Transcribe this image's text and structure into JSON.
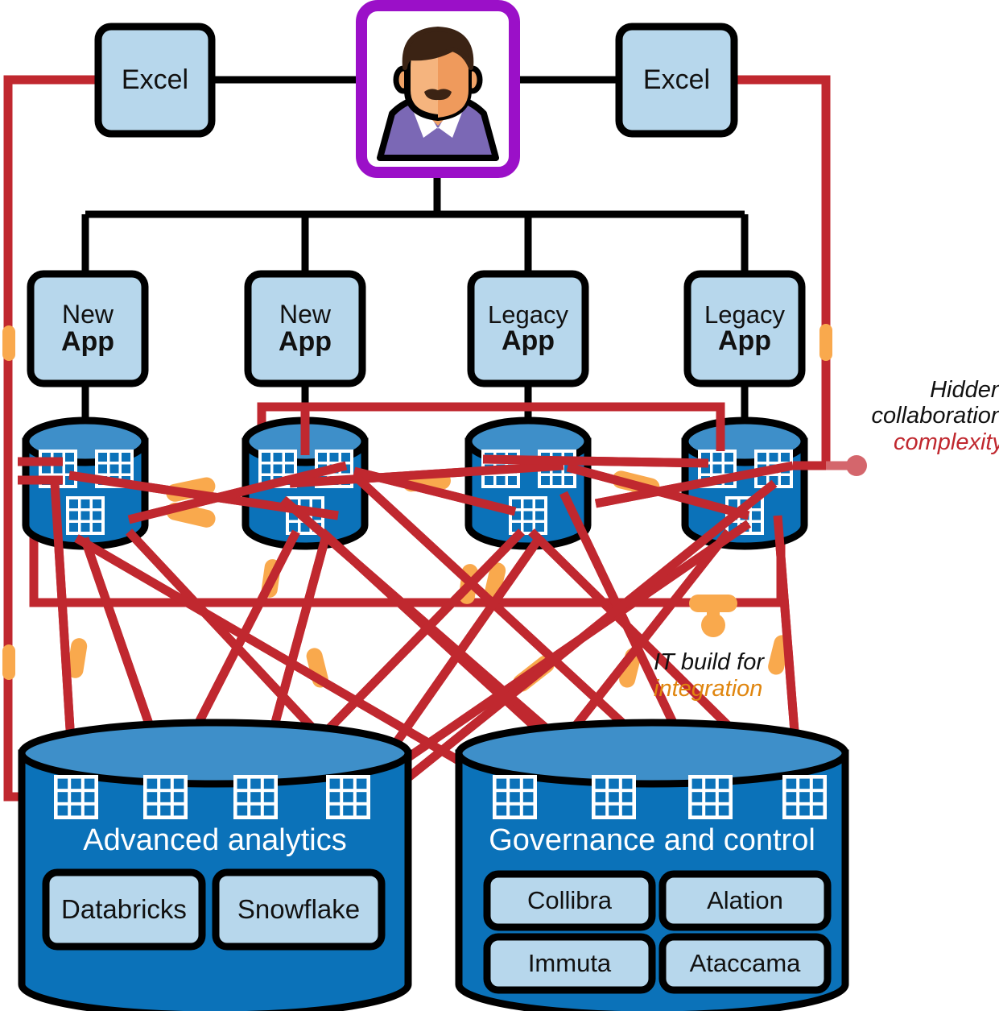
{
  "title": "Hidden collaboration complexity",
  "colors": {
    "app_box_fill": "#b7d7ec",
    "app_box_stroke": "#000000",
    "avatar_frame": "#9b10c8",
    "cylinder_body": "#0b72b9",
    "cylinder_top": "#3e8fc9",
    "cylinder_stroke": "#000000",
    "connector_black": "#000000",
    "connector_red": "#c0282f",
    "marker_orange": "#f9a94d",
    "annotation_red": "#c0282f",
    "annotation_orange": "#e0860f",
    "callout_pink": "#d4666c",
    "grid_icon_white": "#ffffff",
    "tool_chip_fill": "#b7d7ec"
  },
  "top_row": {
    "excel_left": {
      "label": "Excel"
    },
    "excel_right": {
      "label": "Excel"
    },
    "avatar": {
      "name": "user-avatar",
      "alt": "Business user portrait"
    }
  },
  "apps": [
    {
      "line1": "New",
      "line2": "App"
    },
    {
      "line1": "New",
      "line2": "App"
    },
    {
      "line1": "Legacy",
      "line2": "App"
    },
    {
      "line1": "Legacy",
      "line2": "App"
    }
  ],
  "app_databases": [
    {
      "name": "app-database-1",
      "tables": 3
    },
    {
      "name": "app-database-2",
      "tables": 3
    },
    {
      "name": "app-database-3",
      "tables": 3
    },
    {
      "name": "app-database-4",
      "tables": 3
    }
  ],
  "platforms": [
    {
      "name": "advanced-analytics",
      "title": "Advanced analytics",
      "tables": 4,
      "tools": [
        {
          "label": "Databricks"
        },
        {
          "label": "Snowflake"
        }
      ]
    },
    {
      "name": "governance-and-control",
      "title": "Governance and control",
      "tables": 4,
      "tools": [
        {
          "label": "Collibra"
        },
        {
          "label": "Alation"
        },
        {
          "label": "Immuta"
        },
        {
          "label": "Ataccama"
        }
      ]
    }
  ],
  "annotations": [
    {
      "name": "hidden-collaboration-complexity",
      "lines": [
        {
          "text": "Hidden",
          "emphasis": false
        },
        {
          "text": "collaboration",
          "emphasis": false
        },
        {
          "text": "complexity",
          "emphasis": true
        }
      ]
    },
    {
      "name": "it-build-for-integration",
      "lines": [
        {
          "text": "IT build for",
          "emphasis": false
        },
        {
          "text": "integration",
          "emphasis": true
        }
      ]
    }
  ]
}
